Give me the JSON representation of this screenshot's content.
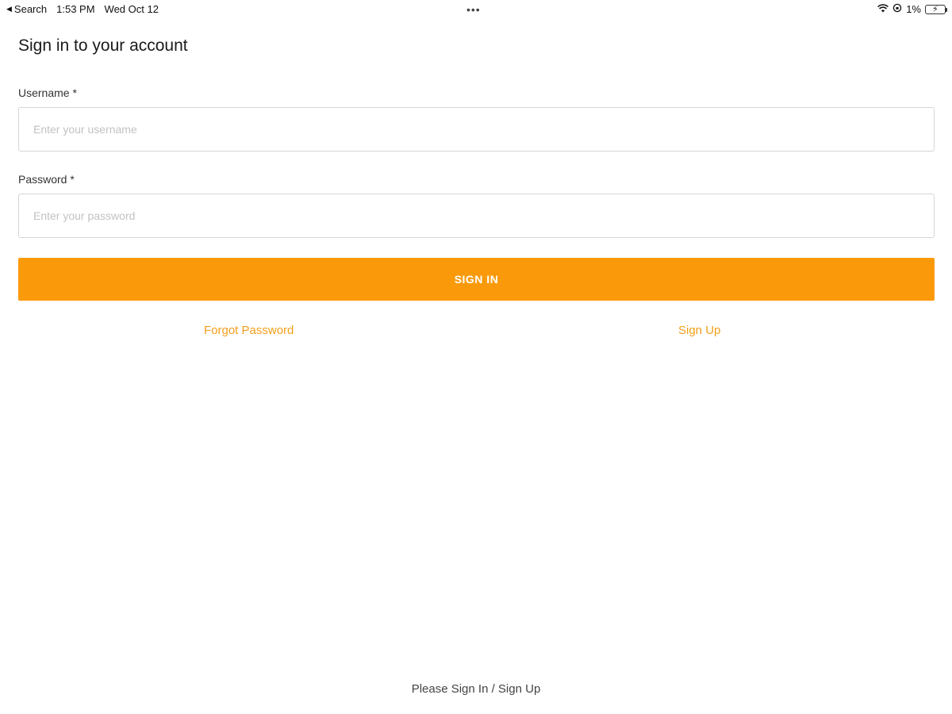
{
  "status_bar": {
    "back_label": "Search",
    "time": "1:53 PM",
    "date": "Wed Oct 12",
    "dots": "•••",
    "battery_text": "1%",
    "icons": [
      "back-arrow-icon",
      "wifi-icon",
      "orientation-lock-icon",
      "battery-icon"
    ]
  },
  "form": {
    "title": "Sign in to your account",
    "username_label": "Username *",
    "username_placeholder": "Enter your username",
    "username_value": "",
    "password_label": "Password *",
    "password_placeholder": "Enter your password",
    "password_value": "",
    "signin_label": "SIGN IN",
    "forgot_label": "Forgot Password",
    "signup_label": "Sign Up"
  },
  "footer": {
    "text": "Please Sign In / Sign Up"
  },
  "colors": {
    "accent": "#FA9A0A",
    "link": "#F29E1B"
  }
}
